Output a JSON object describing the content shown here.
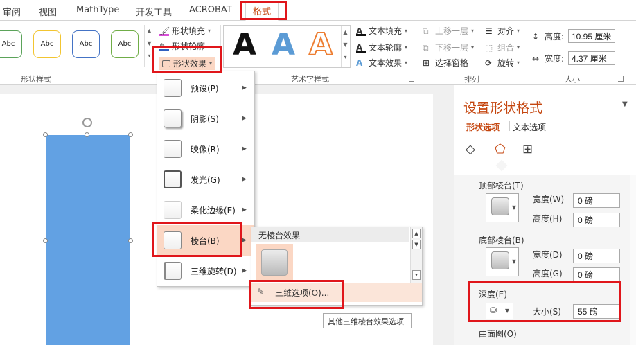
{
  "tabs": [
    "审阅",
    "视图",
    "MathType",
    "开发工具",
    "ACROBAT",
    "格式"
  ],
  "ribbon": {
    "shape_styles": {
      "thumbs": [
        {
          "text": "Abc",
          "color": "#5ba35a"
        },
        {
          "text": "Abc",
          "color": "#f2c531"
        },
        {
          "text": "Abc",
          "color": "#4473c5"
        },
        {
          "text": "Abc",
          "color": "#70ad47"
        }
      ],
      "fill": "形状填充",
      "outline": "形状轮廓",
      "effects": "形状效果",
      "group_label": "形状样式"
    },
    "wordart": {
      "letters": [
        {
          "text": "A",
          "color": "#111111"
        },
        {
          "text": "A",
          "color": "#5b9bd5"
        },
        {
          "text": "A",
          "color": "#ed7d31"
        }
      ],
      "text_fill": "文本填充",
      "text_outline": "文本轮廓",
      "text_effects": "文本效果",
      "group_label": "艺术字样式"
    },
    "arrange": {
      "bring_forward": "上移一层",
      "send_backward": "下移一层",
      "selection_pane": "选择窗格",
      "align": "对齐",
      "group": "组合",
      "rotate": "旋转",
      "group_label": "排列"
    },
    "size": {
      "height_label": "高度:",
      "height_value": "10.95 厘米",
      "width_label": "宽度:",
      "width_value": "4.37 厘米",
      "group_label": "大小"
    }
  },
  "effects_menu": [
    {
      "label": "预设(P)",
      "has_arrow": true
    },
    {
      "label": "阴影(S)",
      "has_arrow": true
    },
    {
      "label": "映像(R)",
      "has_arrow": true
    },
    {
      "label": "发光(G)",
      "has_arrow": true
    },
    {
      "label": "柔化边缘(E)",
      "has_arrow": true
    },
    {
      "label": "棱台(B)",
      "has_arrow": true
    },
    {
      "label": "三维旋转(D)",
      "has_arrow": true
    }
  ],
  "bevel_submenu": {
    "header": "无棱台效果",
    "option_3d": "三维选项(O)...",
    "tooltip": "其他三维棱台效果选项"
  },
  "format_pane": {
    "title": "设置形状格式",
    "tab_shape": "形状选项",
    "tab_text": "文本选项",
    "top_bevel": {
      "label": "顶部棱台(T)",
      "width_label": "宽度(W)",
      "width_value": "0 磅",
      "height_label": "高度(H)",
      "height_value": "0 磅"
    },
    "bottom_bevel": {
      "label": "底部棱台(B)",
      "width_label": "宽度(D)",
      "width_value": "0 磅",
      "height_label": "高度(G)",
      "height_value": "0 磅"
    },
    "depth": {
      "label": "深度(E)",
      "size_label": "大小(S)",
      "size_value": "55 磅"
    },
    "contour_label": "曲面图(O)"
  },
  "colors": {
    "accent": "#c5460f",
    "highlight": "#fbd7c4",
    "shape_fill": "#62a1e3",
    "annotation_red": "#e0161b"
  }
}
